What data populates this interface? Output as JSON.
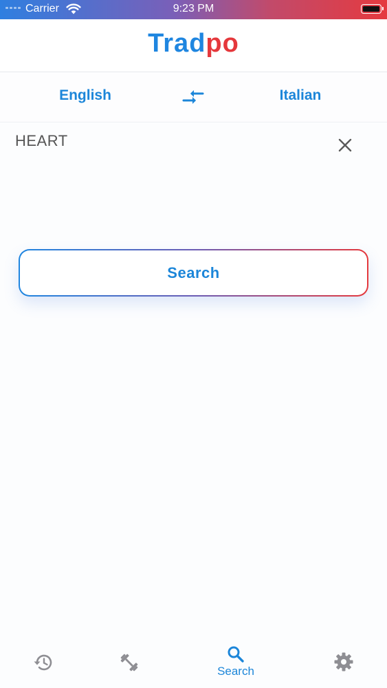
{
  "status_bar": {
    "carrier": "Carrier",
    "time": "9:23 PM"
  },
  "header": {
    "logo_part1": "Trad",
    "logo_part2": "po"
  },
  "languages": {
    "source": "English",
    "target": "Italian"
  },
  "input": {
    "value": "HEART"
  },
  "search_button": {
    "label": "Search"
  },
  "tab_bar": {
    "tabs": [
      {
        "icon": "history-icon",
        "label": ""
      },
      {
        "icon": "dumbbell-icon",
        "label": ""
      },
      {
        "icon": "search-icon",
        "label": "Search",
        "active": true
      },
      {
        "icon": "gear-icon",
        "label": ""
      }
    ]
  },
  "colors": {
    "brand_blue": "#1f86e0",
    "brand_red": "#e5383c",
    "icon_gray": "#8e8e93"
  }
}
